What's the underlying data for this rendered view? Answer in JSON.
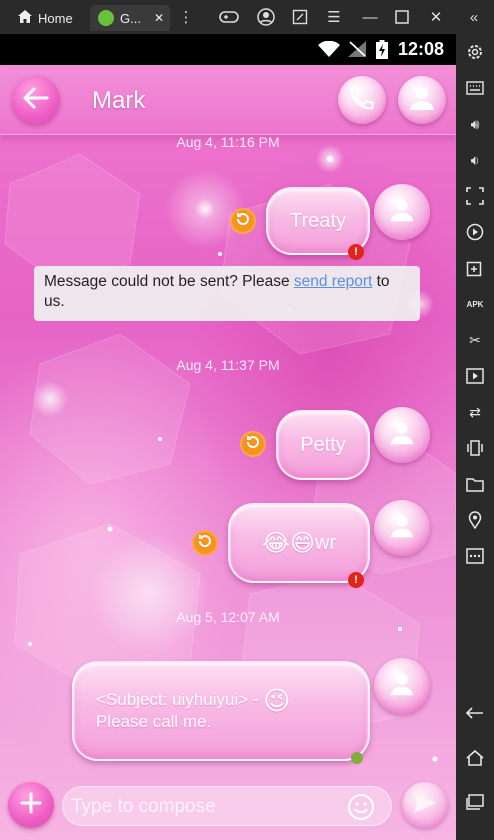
{
  "emulator": {
    "tabs": [
      {
        "label": "Home"
      },
      {
        "label": "G..."
      }
    ],
    "icons": [
      "gamepad-icon",
      "account-icon",
      "screenshot-icon",
      "menu-icon",
      "minimize-icon",
      "maximize-icon",
      "close-icon",
      "expand-icon"
    ],
    "sidebar_icons": [
      "settings-icon",
      "keyboard-icon",
      "volume-up-icon",
      "volume-down-icon",
      "screen-record-icon",
      "play-icon",
      "add-app-icon",
      "apk-icon",
      "cut-icon",
      "video-icon",
      "sync-icon",
      "shake-icon",
      "folder-icon",
      "location-icon",
      "more-icon",
      "back-icon",
      "home-icon",
      "recents-icon"
    ]
  },
  "status_bar": {
    "time": "12:08"
  },
  "conversation": {
    "contact_name": "Mark"
  },
  "messages": [
    {
      "timestamp": "Aug 4, 11:16 PM",
      "text": "Treaty",
      "failed": true
    },
    {
      "notice_pre": "Message could not be sent? Please ",
      "notice_link": "send report",
      "notice_post": " to us."
    },
    {
      "timestamp": "Aug 4, 11:37 PM",
      "text": "Petty",
      "failed": false
    },
    {
      "text": "wr",
      "emoji": "😂😄",
      "failed": true
    },
    {
      "timestamp": "Aug 5, 12:07 AM",
      "text_line1": "<Subject: uiyhuiyui> - ",
      "emoji": "😉",
      "text_line2": "Please call me."
    }
  ],
  "composer": {
    "placeholder": "Type to compose"
  },
  "colors": {
    "accent_pink": "#e663c6",
    "retry_orange": "#f7941d",
    "error_red": "#e2231a",
    "link_blue": "#5b8fe0"
  }
}
